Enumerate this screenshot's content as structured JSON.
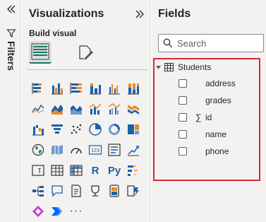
{
  "filters": {
    "label": "Filters"
  },
  "visualizations": {
    "title": "Visualizations",
    "build_visual_label": "Build visual",
    "more_label": "···",
    "r_label": "R",
    "py_label": "Py",
    "gallery_rows": [
      [
        "stacked-bar-chart",
        "clustered-bar-chart",
        "100-stacked-bar-chart",
        "stacked-column-chart",
        "clustered-column-chart",
        "100-stacked-column-chart"
      ],
      [
        "line-chart",
        "area-chart",
        "stacked-area-chart",
        "line-and-column-chart",
        "line-and-clustered-column-chart",
        "ribbon-chart"
      ],
      [
        "waterfall-chart",
        "funnel-chart",
        "scatter-chart",
        "pie-chart",
        "donut-chart",
        "treemap"
      ],
      [
        "map",
        "filled-map",
        "gauge",
        "card",
        "multi-row-card",
        "kpi"
      ],
      [
        "slicer",
        "table",
        "matrix",
        "r-visual",
        "python-visual",
        "key-influencers"
      ],
      [
        "decomposition-tree",
        "qa-visual",
        "smart-narrative",
        "paginated-report",
        "power-apps",
        "power-automate"
      ]
    ]
  },
  "fields": {
    "title": "Fields",
    "search_placeholder": "Search",
    "table_name": "Students",
    "items": [
      {
        "label": "address",
        "sigma": ""
      },
      {
        "label": "grades",
        "sigma": ""
      },
      {
        "label": "id",
        "sigma": "∑"
      },
      {
        "label": "name",
        "sigma": ""
      },
      {
        "label": "phone",
        "sigma": ""
      }
    ]
  },
  "colors": {
    "highlight_border": "#d72a35",
    "accent_teal": "#117865",
    "icon_blue": "#1f5fa8",
    "icon_orange": "#e8892d"
  }
}
